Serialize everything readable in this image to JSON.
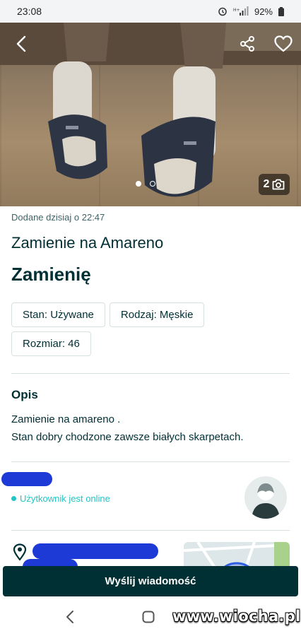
{
  "status_bar": {
    "time": "23:08",
    "battery": "92%"
  },
  "gallery": {
    "photo_count": "2",
    "total_photos": 2,
    "current_photo": 1
  },
  "listing": {
    "posted": "Dodane dzisiaj o 22:47",
    "title": "Zamienie na Amareno",
    "price": "Zamienię",
    "params": [
      {
        "label": "Stan: Używane"
      },
      {
        "label": "Rodzaj: Męskie"
      },
      {
        "label": "Rozmiar: 46"
      }
    ],
    "description_heading": "Opis",
    "description_lines": [
      "Zamienie na amareno .",
      "Stan dobry chodzone zawsze białych skarpetach."
    ]
  },
  "seller": {
    "online_text": "Użytkownik jest online"
  },
  "actions": {
    "send_message": "Wyślij wiadomość"
  },
  "watermark": "www.wiocha.pl",
  "colors": {
    "primary": "#002f34",
    "online": "#23c4c4",
    "redaction": "#1d3ad6"
  }
}
